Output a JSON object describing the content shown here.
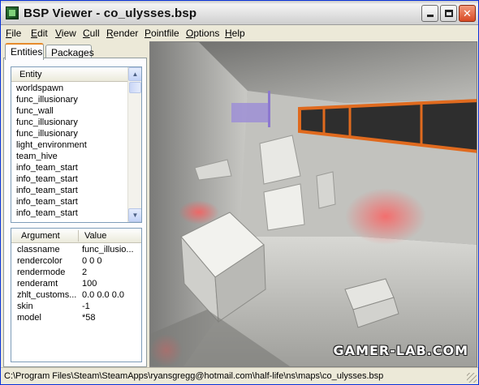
{
  "window": {
    "title": "BSP Viewer - co_ulysses.bsp",
    "minimize_icon": "minimize-icon",
    "maximize_icon": "maximize-icon",
    "close_icon": "close-icon",
    "close_symbol": "✕"
  },
  "menu": [
    {
      "label": "File"
    },
    {
      "label": "Edit"
    },
    {
      "label": "View"
    },
    {
      "label": "Cull"
    },
    {
      "label": "Render"
    },
    {
      "label": "Pointfile"
    },
    {
      "label": "Options"
    },
    {
      "label": "Help"
    }
  ],
  "tabs": {
    "entities": "Entities",
    "packages": "Packages",
    "active": "Entities"
  },
  "entity_list": {
    "header": "Entity",
    "items": [
      "worldspawn",
      "func_illusionary",
      "func_wall",
      "func_illusionary",
      "func_illusionary",
      "light_environment",
      "team_hive",
      "info_team_start",
      "info_team_start",
      "info_team_start",
      "info_team_start",
      "info_team_start"
    ]
  },
  "properties": {
    "header_argument": "Argument",
    "header_value": "Value",
    "rows": [
      {
        "argument": "classname",
        "value": "func_illusio..."
      },
      {
        "argument": "rendercolor",
        "value": "0 0 0"
      },
      {
        "argument": "rendermode",
        "value": "2"
      },
      {
        "argument": "renderamt",
        "value": "100"
      },
      {
        "argument": "zhlt_customs...",
        "value": "0.0 0.0 0.0"
      },
      {
        "argument": "skin",
        "value": "-1"
      },
      {
        "argument": "model",
        "value": "*58"
      }
    ]
  },
  "viewport": {
    "watermark": "GAMER-LAB.COM"
  },
  "statusbar": {
    "path": "C:\\Program Files\\Steam\\SteamApps\\ryansgregg@hotmail.com\\half-life\\ns\\maps\\co_ulysses.bsp"
  },
  "colors": {
    "title_gradient_top": "#f4f4f4",
    "close_button": "#d84a24",
    "active_tab_accent": "#e68b2c",
    "window_face": "#ece9d8",
    "neon_orange": "#e06a1e"
  }
}
